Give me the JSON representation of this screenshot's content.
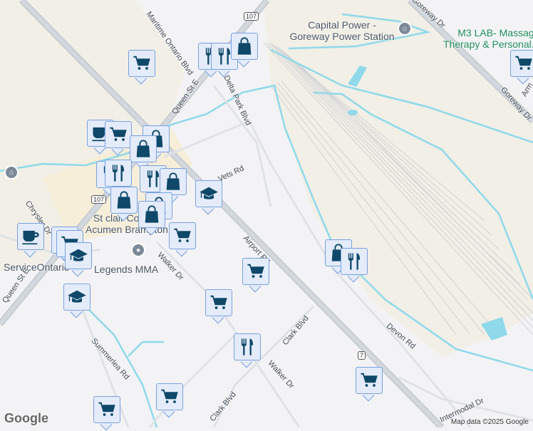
{
  "places": {
    "power_station": "Capital Power - Goreway Power Station",
    "m3lab_line1": "M3 LAB- Massage",
    "m3lab_line2": "Therapy & Personal...",
    "stclair_line1": "St clair College",
    "stclair_line2": "Acumen Brampton",
    "service_ontario": "ServiceOntario",
    "legends": "Legends MMA"
  },
  "roads": {
    "goreway_top": "Goreway Dr",
    "goreway_right": "Goreway Dr",
    "maritime": "Maritime Ontario Blvd",
    "queen_top": "Queen St E",
    "queen_bottom": "Queen St E",
    "delta_park": "Delta Park Blvd",
    "vets": "Vets Rd",
    "airport": "Airport Rd",
    "walker_1": "Walker Dr",
    "walker_2": "Walker Dr",
    "clark_1": "Clark Blvd",
    "clark_2": "Clark Blvd",
    "devon": "Devon Rd",
    "intermodal": "Intermodal Dr",
    "summerlea": "Summerlea Rd",
    "chrysler": "Chrysler Dr",
    "armstrong": "Arm"
  },
  "shields": {
    "hwy107_top": "107",
    "hwy107_mid": "107",
    "hwy7": "7"
  },
  "markers": [
    "shopping-cart",
    "restaurant",
    "restaurant",
    "shopping-bag",
    "cafe",
    "shopping-cart",
    "shopping-bag",
    "shopping-bag",
    "restaurant",
    "restaurant",
    "restaurant",
    "shopping-bag",
    "school",
    "shopping-bag",
    "shopping-bag",
    "shopping-bag",
    "shopping-cart",
    "cafe",
    "shopping-cart",
    "shopping-cart",
    "school",
    "shopping-cart",
    "school",
    "shopping-cart",
    "restaurant",
    "shopping-bag",
    "restaurant",
    "shopping-cart",
    "shopping-cart",
    "shopping-cart",
    "shopping-cart"
  ],
  "footer": {
    "attribution": "Map data ©2025 Google",
    "logo": "Google"
  },
  "colors": {
    "marker_icon": "#0f4869",
    "marker_bg": "#e4ecfb",
    "water": "#8fd9ea",
    "land_industrial": "#f2efe6"
  }
}
